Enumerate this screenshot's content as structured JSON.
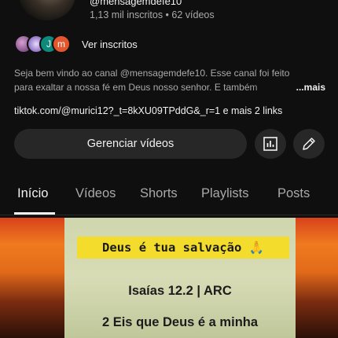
{
  "channel": {
    "handle": "@mensagemdefe10",
    "stats": "1,13 mil inscritos • 62 vídeos"
  },
  "subscribers": {
    "avatars": [
      {
        "initial": ""
      },
      {
        "initial": ""
      },
      {
        "initial": "J"
      },
      {
        "initial": "m"
      }
    ],
    "link_label": "Ver inscritos"
  },
  "description": {
    "line1": "Seja bem vindo ao canal @mensagemdefe10. Esse canal foi feito",
    "line2": "para exaltar a nossa fé em Deus nosso senhor. E também ",
    "more_label": "...mais"
  },
  "links": {
    "text": "tiktok.com/@murici12?_t=8kXU09TPddG&_r=1 e mais 2 links"
  },
  "actions": {
    "manage_label": "Gerenciar vídeos",
    "analytics_icon": "analytics-icon",
    "edit_icon": "edit-pencil-icon"
  },
  "tabs": [
    {
      "label": "Início",
      "active": true
    },
    {
      "label": "Vídeos",
      "active": false
    },
    {
      "label": "Shorts",
      "active": false
    },
    {
      "label": "Playlists",
      "active": false
    },
    {
      "label": "Posts",
      "active": false
    }
  ],
  "post": {
    "banner": "Deus é tua salvação 🙏",
    "reference": "Isaías 12.2 | ARC",
    "verse_line1": "2 Eis que Deus é a minha"
  },
  "colors": {
    "background": "#0f0f0f",
    "button": "#272727",
    "secondary_text": "#aaaaaa",
    "banner": "#f3dc2b"
  }
}
